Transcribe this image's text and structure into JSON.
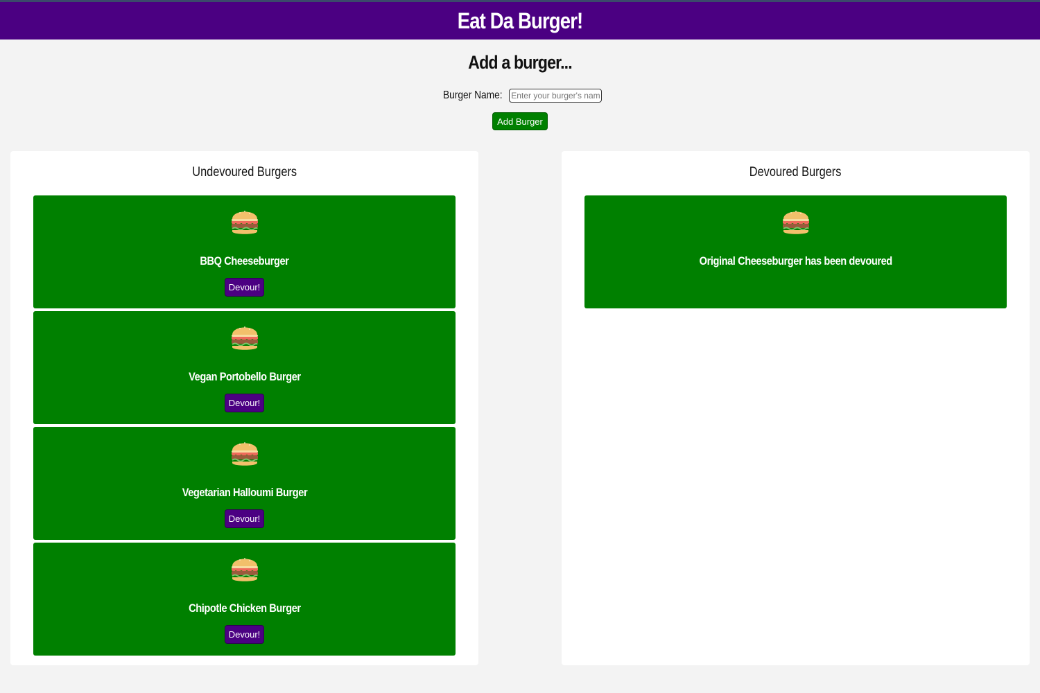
{
  "header": {
    "title": "Eat Da Burger!"
  },
  "add_form": {
    "title": "Add a burger...",
    "label": "Burger Name:",
    "placeholder": "Enter your burger's name",
    "value": "",
    "button": "Add Burger"
  },
  "undevoured": {
    "title": "Undevoured Burgers",
    "items": [
      {
        "name": "BBQ Cheeseburger",
        "button": "Devour!"
      },
      {
        "name": "Vegan Portobello Burger",
        "button": "Devour!"
      },
      {
        "name": "Vegetarian Halloumi Burger",
        "button": "Devour!"
      },
      {
        "name": "Chipotle Chicken Burger",
        "button": "Devour!"
      }
    ]
  },
  "devoured": {
    "title": "Devoured Burgers",
    "items": [
      {
        "name": "Original Cheeseburger has been devoured"
      }
    ]
  },
  "colors": {
    "header_bg": "#4b0082",
    "card_bg": "#008000",
    "devour_button_bg": "#4b0082",
    "add_button_bg": "#008000",
    "page_bg": "#f3f3f3"
  },
  "icons": {
    "burger": "burger-icon"
  }
}
